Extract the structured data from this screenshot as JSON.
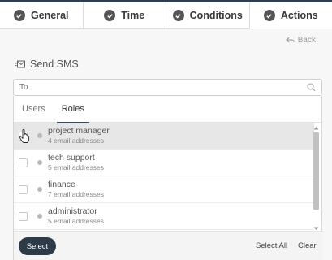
{
  "tabs": [
    {
      "label": "General",
      "icon": "check-circle-icon"
    },
    {
      "label": "Time",
      "icon": "check-circle-icon"
    },
    {
      "label": "Conditions",
      "icon": "check-circle-icon"
    },
    {
      "label": "Actions",
      "icon": "check-circle-icon",
      "active": true
    }
  ],
  "back_label": "Back",
  "send_sms_label": "Send SMS",
  "to_field": {
    "placeholder": "To",
    "value": ""
  },
  "subtabs": [
    {
      "label": "Users"
    },
    {
      "label": "Roles",
      "active": true
    }
  ],
  "roles": [
    {
      "name": "project manager",
      "detail": "4 email addresses"
    },
    {
      "name": "tech support",
      "detail": "5 email addresses"
    },
    {
      "name": "finance",
      "detail": "7 email addresses"
    },
    {
      "name": "administrator",
      "detail": "5 email addresses"
    }
  ],
  "footer": {
    "select_label": "Select",
    "select_all_label": "Select All",
    "clear_label": "Clear"
  },
  "colors": {
    "accent": "#2d3a48",
    "tab_icon": "#555555",
    "status_dot": "#b8b8b8"
  }
}
